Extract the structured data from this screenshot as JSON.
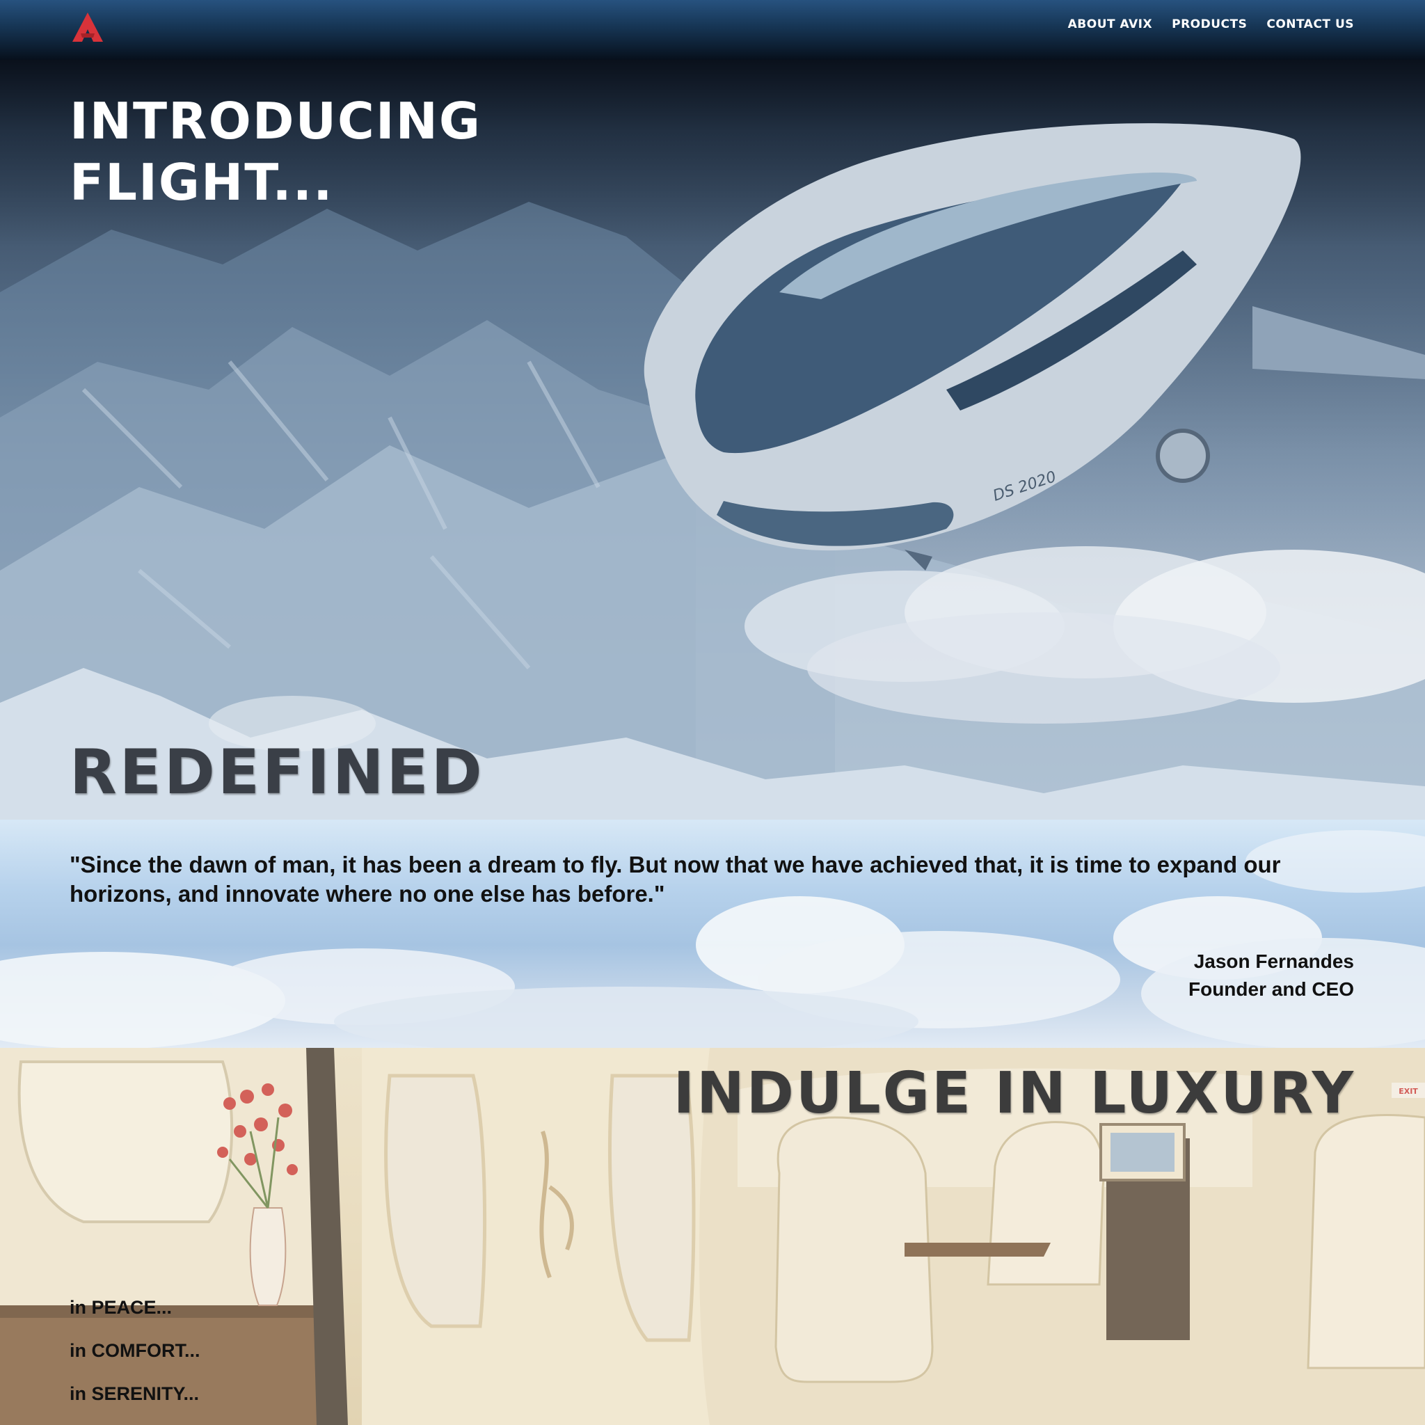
{
  "nav": {
    "logo_letter": "A",
    "links": [
      "ABOUT AVIX",
      "PRODUCTS",
      "CONTACT US"
    ]
  },
  "hero": {
    "title": "INTRODUCING\nFLIGHT...",
    "subtitle": "REDEFINED",
    "airship_label": "DS 2020"
  },
  "quote": {
    "text": "\"Since the dawn of man, it has been a dream to fly. But now that we have achieved that, it is time to expand our horizons, and innovate where no one else has before.\"",
    "author_name": "Jason Fernandes",
    "author_title": "Founder and CEO"
  },
  "luxury": {
    "title": "INDULGE IN LUXURY",
    "items": [
      "in PEACE...",
      "in COMFORT...",
      "in SERENITY..."
    ],
    "exit_sign": "EXIT"
  },
  "colors": {
    "nav_top": "#27527f",
    "nav_bottom": "#07101c",
    "logo_red": "#d8333a",
    "heading_dark": "#3a3f47"
  }
}
